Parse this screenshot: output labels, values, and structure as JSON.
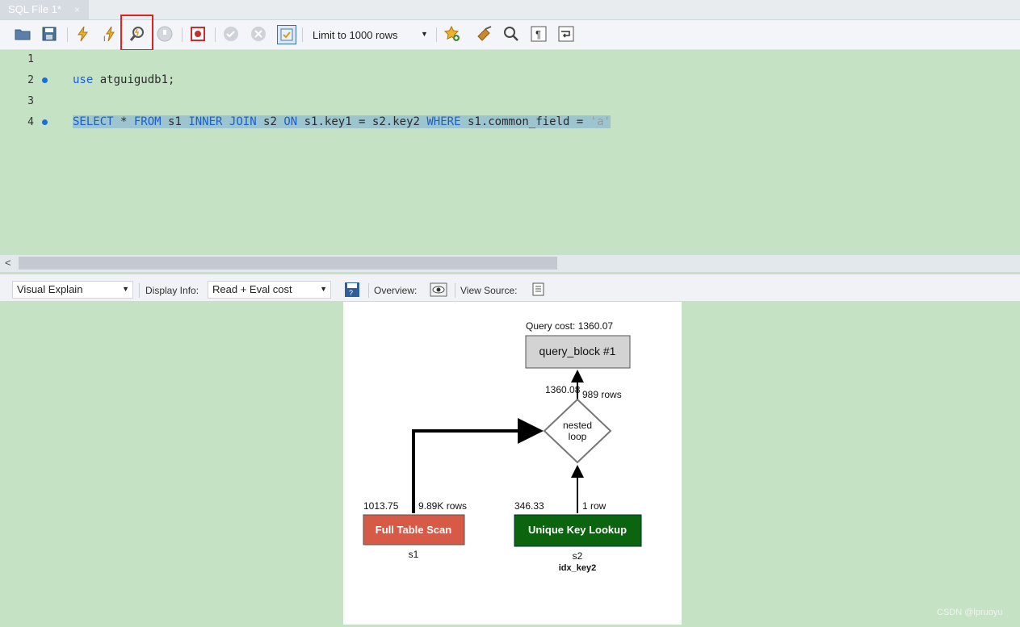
{
  "tab": {
    "title": "SQL File 1*",
    "close": "×"
  },
  "toolbar": {
    "limit": "Limit to 1000 rows",
    "icons": [
      "open-folder-icon",
      "save-icon",
      "execute-lightning-icon",
      "execute-statement-icon",
      "explain-magnifier-icon",
      "stop-icon",
      "toggle-error-icon",
      "commit-icon",
      "rollback-icon",
      "autocommit-icon",
      "limit-dropdown",
      "add-snippet-star-icon",
      "beautify-broom-icon",
      "find-icon",
      "invisible-chars-icon",
      "wrap-lines-icon"
    ]
  },
  "editor": {
    "lines": [
      "1",
      "2",
      "3",
      "4"
    ],
    "line2": {
      "kw": "use",
      "rest": " atguigudb1;"
    },
    "line4": {
      "tokens": [
        {
          "t": "SELECT",
          "k": "kw"
        },
        {
          "t": " * ",
          "k": "plain"
        },
        {
          "t": "FROM",
          "k": "kw"
        },
        {
          "t": " s1 ",
          "k": "plain"
        },
        {
          "t": "INNER",
          "k": "kw"
        },
        {
          "t": " ",
          "k": "plain"
        },
        {
          "t": "JOIN",
          "k": "kw"
        },
        {
          "t": " s2 ",
          "k": "plain"
        },
        {
          "t": "ON",
          "k": "kw"
        },
        {
          "t": " s1.key1 = s2.key2 ",
          "k": "plain"
        },
        {
          "t": "WHERE",
          "k": "kw"
        },
        {
          "t": " s1.common_field = ",
          "k": "plain"
        },
        {
          "t": "'a'",
          "k": "str"
        }
      ]
    }
  },
  "explain": {
    "mode": "Visual Explain",
    "display_info_label": "Display Info:",
    "display_info_value": "Read + Eval cost",
    "overview_label": "Overview:",
    "view_source_label": "View Source:"
  },
  "diagram": {
    "query_cost": "Query cost: 1360.07",
    "query_block": "query_block #1",
    "top_cost": "1360.08",
    "top_rows": "989 rows",
    "loop_line1": "nested",
    "loop_line2": "loop",
    "left_cost": "1013.75",
    "left_rows": "9.89K rows",
    "right_cost": "346.33",
    "right_rows": "1 row",
    "full_scan": "Full Table Scan",
    "full_scan_color": "#d65a45",
    "unique_lookup": "Unique Key Lookup",
    "unique_lookup_color": "#0b640e",
    "left_table": "s1",
    "right_table": "s2",
    "right_index": "idx_key2"
  },
  "watermark": "CSDN @lpruoyu"
}
